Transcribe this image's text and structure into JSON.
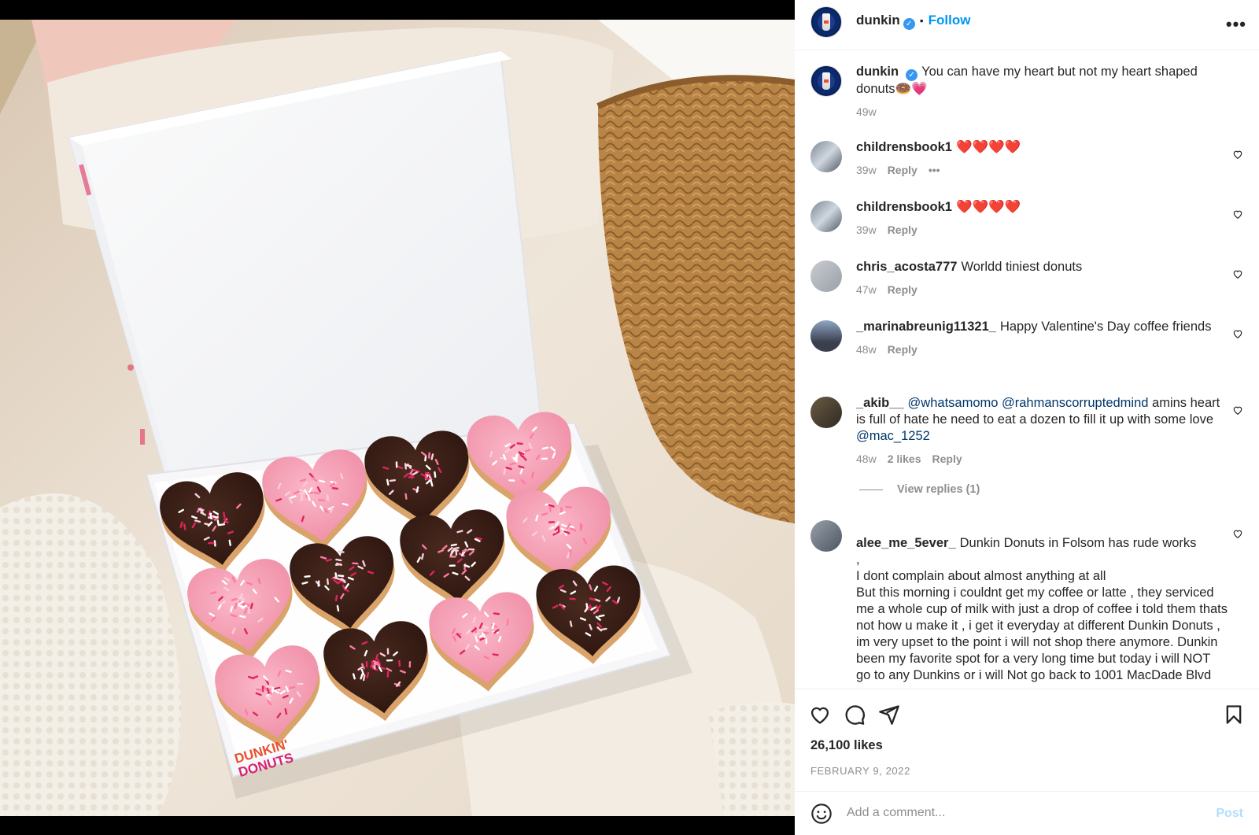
{
  "header": {
    "username": "dunkin",
    "verified_glyph": "✓",
    "separator": "•",
    "follow_label": "Follow",
    "more_label": "•••"
  },
  "caption": {
    "username": "dunkin",
    "text": "You can have my heart but not my heart shaped donuts🍩💗",
    "time": "49w"
  },
  "comments": [
    {
      "username": "childrensbook1",
      "text": "❤️❤️❤️❤️",
      "time": "39w",
      "reply": "Reply",
      "more": "•••"
    },
    {
      "username": "childrensbook1",
      "text": "❤️❤️❤️❤️",
      "time": "39w",
      "reply": "Reply"
    },
    {
      "username": "chris_acosta777",
      "text": "Worldd tiniest donuts",
      "time": "47w",
      "reply": "Reply"
    },
    {
      "username": "_marinabreunig11321_",
      "text": "Happy Valentine's Day coffee friends",
      "time": "48w",
      "reply": "Reply"
    },
    {
      "username": "_akib__",
      "mention1": "@whatsamomo",
      "mention2": "@rahmanscorruptedmind",
      "text": "amins heart is full of hate he need to eat a dozen to fill it up with some love",
      "mention3": "@mac_1252",
      "time": "48w",
      "likes": "2 likes",
      "reply": "Reply"
    },
    {
      "username": "alee_me_5ever_",
      "text": "Dunkin Donuts in Folsom has rude works\n,\nI dont complain about almost anything at all\nBut this morning i couldnt get my coffee or latte , they serviced me a whole cup of milk with just a drop of coffee i told them thats not how u make it , i get it everyday at different Dunkin Donuts , im very upset to the point i will not shop there anymore. Dunkin been my favorite spot for a very long time but today i will NOT go to any Dunkins or i will Not go back to 1001 MacDade Blvd"
    }
  ],
  "view_replies": "View replies (1)",
  "actions": {
    "likes": "26,100 likes",
    "date": "FEBRUARY 9, 2022"
  },
  "compose": {
    "placeholder": "Add a comment...",
    "post_label": "Post",
    "emoji_icon": "smiley-icon"
  },
  "media": {
    "box_brand_line1": "DUNKIN'",
    "box_brand_line2": "DONUTS"
  },
  "colors": {
    "link": "#0095f6",
    "mention": "#00376b",
    "muted": "#8e8e8e",
    "chocolate": "#3b1f17",
    "pink_frosting": "#f39bb3"
  }
}
